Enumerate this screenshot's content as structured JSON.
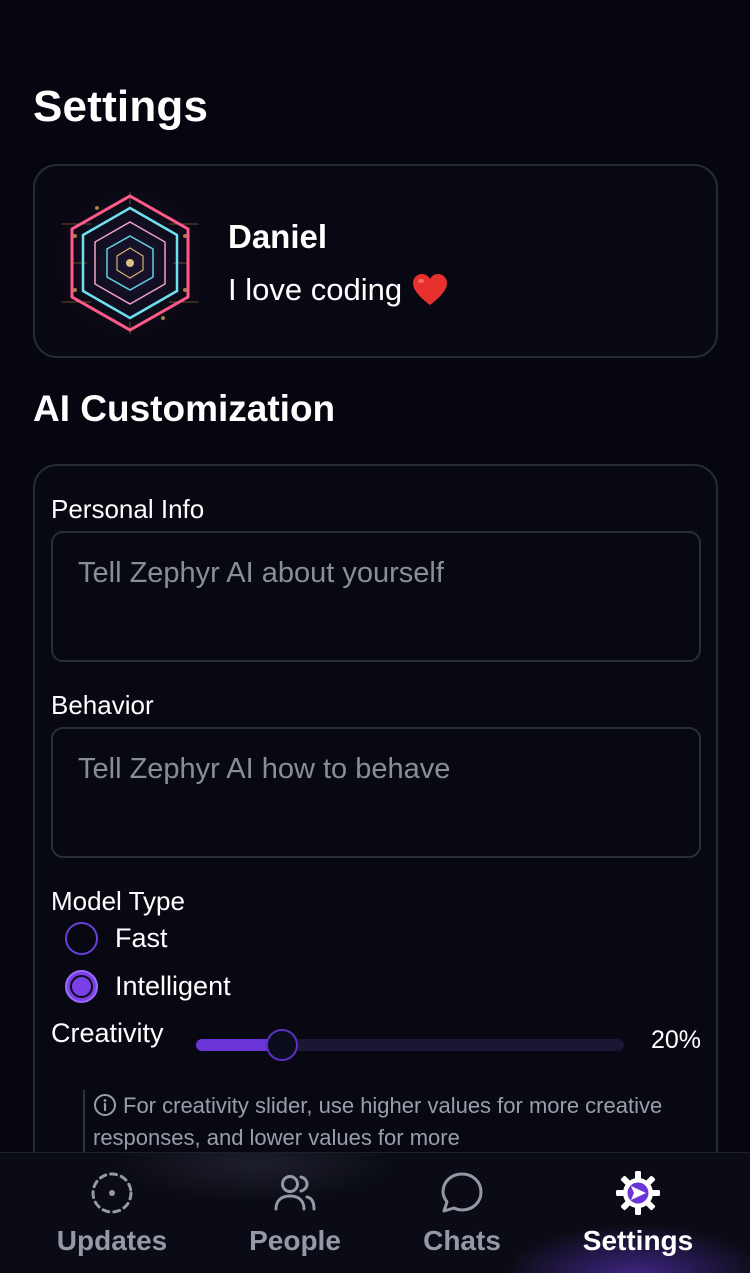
{
  "header": {
    "title": "Settings"
  },
  "profile": {
    "name": "Daniel",
    "bio": "I love coding"
  },
  "ai_customization": {
    "title": "AI Customization",
    "personal_info": {
      "label": "Personal Info",
      "placeholder": "Tell Zephyr AI about yourself",
      "value": ""
    },
    "behavior": {
      "label": "Behavior",
      "placeholder": "Tell Zephyr AI how to behave",
      "value": ""
    },
    "model_type": {
      "label": "Model Type",
      "options": [
        {
          "label": "Fast",
          "selected": false
        },
        {
          "label": "Intelligent",
          "selected": true
        }
      ]
    },
    "creativity": {
      "label": "Creativity",
      "value": 20,
      "value_text": "20%"
    },
    "info_note": "For creativity slider, use higher values for more creative responses, and lower values for more"
  },
  "nav": {
    "items": [
      {
        "label": "Updates",
        "icon": "updates-icon",
        "active": false
      },
      {
        "label": "People",
        "icon": "people-icon",
        "active": false
      },
      {
        "label": "Chats",
        "icon": "chat-icon",
        "active": false
      },
      {
        "label": "Settings",
        "icon": "settings-gear-icon",
        "active": true
      }
    ]
  },
  "colors": {
    "background": "#05060f",
    "accent": "#7a3fe6",
    "border": "#262a36",
    "muted_text": "#9598a6"
  }
}
